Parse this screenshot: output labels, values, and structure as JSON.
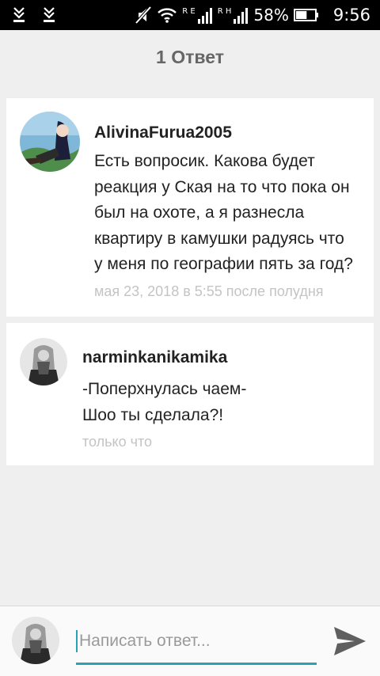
{
  "status_bar": {
    "net1_label": "R E",
    "net2_label": "R H",
    "battery_percent": "58%",
    "battery_level": 0.58,
    "time": "9:56"
  },
  "header": {
    "title": "1 Ответ"
  },
  "comments": [
    {
      "username": "AlivinaFurua2005",
      "message": "Есть вопросик. Какова будет\nреакция у Ская на то что пока он\nбыл на охоте, а я разнесла\nквартиру в камушки радуясь что\nу меня по географии пять за год?",
      "timestamp": "мая 23, 2018 в 5:55 после полудня"
    },
    {
      "username": "narminkanikamika",
      "message": "-Поперхнулась чаем-\nШоо ты сделала?!",
      "timestamp": "только что"
    }
  ],
  "reply": {
    "placeholder": "Написать ответ..."
  },
  "colors": {
    "accent": "#26a3b6",
    "background": "#efefef",
    "timestamp": "#c4c4c4"
  },
  "icons": {
    "status_left": [
      "download-icon",
      "download-icon"
    ],
    "status_right": [
      "mute-icon",
      "wifi-icon",
      "signal-icon",
      "signal-icon",
      "battery-icon"
    ],
    "send": "send-icon"
  }
}
